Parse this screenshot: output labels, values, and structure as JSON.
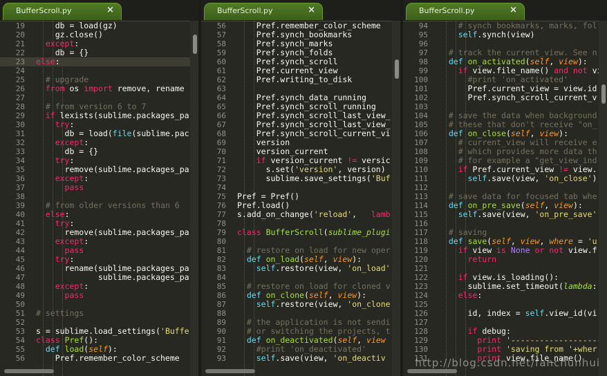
{
  "watermark": "http://blog.csdn.net/fanchunhui",
  "panes": [
    {
      "tab": "BufferScroll.py",
      "lines": [
        [
          "19",
          "    [[db = load(gz)]]"
        ],
        [
          "20",
          "    gz.close()"
        ],
        [
          "21",
          "  [[k:except]]:"
        ],
        [
          "22",
          "    db = {}"
        ],
        [
          "23",
          "[[k:else]]:"
        ],
        [
          "24",
          ""
        ],
        [
          "25",
          "  [[c:# upgrade]]"
        ],
        [
          "26",
          "  [[k:from]] os [[k:import]] remove, rename"
        ],
        [
          "27",
          ""
        ],
        [
          "28",
          "  [[c:# from version 6 to 7]]"
        ],
        [
          "29",
          "  [[k:if]] lexists(sublime.packages_pa"
        ],
        [
          "30",
          "    [[k:try]]:"
        ],
        [
          "31",
          "      db = load([[b:file]](sublime.pac"
        ],
        [
          "32",
          "    [[k:except]]:"
        ],
        [
          "33",
          "      db = {}"
        ],
        [
          "34",
          "    [[k:try]]:"
        ],
        [
          "35",
          "      remove(sublime.packages_pa"
        ],
        [
          "36",
          "    [[k:except]]:"
        ],
        [
          "37",
          "      [[k:pass]]"
        ],
        [
          "38",
          ""
        ],
        [
          "39",
          "  [[c:# from older versions than 6]]"
        ],
        [
          "40",
          "  [[k:else]]:"
        ],
        [
          "41",
          "    [[k:try]]:"
        ],
        [
          "42",
          "      remove(sublime.packages_pa"
        ],
        [
          "43",
          "    [[k:except]]:"
        ],
        [
          "44",
          "      [[k:pass]]"
        ],
        [
          "45",
          "    [[k:try]]:"
        ],
        [
          "46",
          "      rename(sublime.packages_pa"
        ],
        [
          "47",
          "             sublime.packages_pa"
        ],
        [
          "48",
          "    [[k:except]]:"
        ],
        [
          "49",
          "      [[k:pass]]"
        ],
        [
          "50",
          ""
        ],
        [
          "51",
          "[[c:# settings]]"
        ],
        [
          "52",
          ""
        ],
        [
          "53",
          "s = sublime.load_settings([[s:'Buffe]]"
        ],
        [
          "54",
          "[[k:class]] [[f:Pref]]():"
        ],
        [
          "55",
          "  [[b:def]] [[f:load]]([[p:self]]):"
        ],
        [
          "56",
          "    Pref.remember_color_scheme"
        ]
      ]
    },
    {
      "tab": "BufferScroll.py",
      "lines": [
        [
          "56",
          "    Pref.remember_color_scheme"
        ],
        [
          "57",
          "    Pref.synch_bookmarks"
        ],
        [
          "58",
          "    Pref.synch_marks"
        ],
        [
          "59",
          "    Pref.synch_folds"
        ],
        [
          "60",
          "    Pref.synch_scroll"
        ],
        [
          "61",
          "    Pref.current_view"
        ],
        [
          "62",
          "    Pref.writing_to_disk"
        ],
        [
          "63",
          ""
        ],
        [
          "64",
          "    Pref.synch_data_running"
        ],
        [
          "65",
          "    Pref.synch_scroll_running"
        ],
        [
          "66",
          "    Pref.synch_scroll_last_view_"
        ],
        [
          "67",
          "    Pref.synch_scroll_last_view_"
        ],
        [
          "68",
          "    Pref.synch_scroll_current_vi"
        ],
        [
          "69",
          "    version"
        ],
        [
          "70",
          "    version_current"
        ],
        [
          "71",
          "    [[k:if]] version_current [[k:!=]] versic"
        ],
        [
          "72",
          "      s.set([[s:'version']], version)"
        ],
        [
          "73",
          "      sublime.save_settings([[s:'Buf]]"
        ],
        [
          "74",
          ""
        ],
        [
          "75",
          "Pref = Pref()"
        ],
        [
          "76",
          "Pref.load()"
        ],
        [
          "77",
          "s.add_on_change([[s:'reload']],   [[k:lamb]]"
        ],
        [
          "78",
          ""
        ],
        [
          "79",
          "[[k:class]] [[f:BufferScroll]]([[ih:sublime_plugi]]"
        ],
        [
          "80",
          ""
        ],
        [
          "81",
          "  [[c:# restore on load for new oper]]"
        ],
        [
          "82",
          "  [[b:def]] [[f:on_load]]([[p:self]], [[p:view]]):"
        ],
        [
          "83",
          "    [[b:self]].restore(view, [[s:'on_load']]"
        ],
        [
          "84",
          ""
        ],
        [
          "85",
          "  [[c:# restore on load for cloned v]]"
        ],
        [
          "86",
          "  [[b:def]] [[f:on_clone]]([[p:self]], [[p:view]]):"
        ],
        [
          "87",
          "    [[b:self]].restore(view, [[s:'on_clone]]"
        ],
        [
          "88",
          ""
        ],
        [
          "89",
          "  [[c:# the application is not sendi]]"
        ],
        [
          "90",
          "  [[c:# or switching the projects, t]]"
        ],
        [
          "91",
          "  [[b:def]] [[f:on_deactivated]]([[p:self]], [[p:view]]"
        ],
        [
          "92",
          "    [[c:#print 'on_deactivated']]"
        ],
        [
          "93",
          "    [[b:self]].save(view, [[s:'on_deactiv]]"
        ]
      ]
    },
    {
      "tab": "BufferScroll.py",
      "lines": [
        [
          "94",
          "    [[c:# synch bookmarks, marks, fol]]"
        ],
        [
          "95",
          "    [[b:self]].synch(view)"
        ],
        [
          "96",
          ""
        ],
        [
          "97",
          "  [[c:# track the current_view. See n]]"
        ],
        [
          "98",
          "  [[b:def]] [[f:on_activated]]([[p:self]], [[p:view]]):"
        ],
        [
          "99",
          "    [[k:if]] view.file_name() [[k:and]] [[k:not]] vi"
        ],
        [
          "100",
          "      [[c:#print 'on_activated']]"
        ],
        [
          "101",
          "      Pref.current_view = view.id"
        ],
        [
          "102",
          "      Pref.synch_scroll_current_v"
        ],
        [
          "103",
          ""
        ],
        [
          "104",
          "  [[c:# save the data when background]]"
        ],
        [
          "105",
          "  [[c:# these that don't receive \"on_]]"
        ],
        [
          "106",
          "  [[b:def]] [[f:on_close]]([[p:self]], [[p:view]]):"
        ],
        [
          "107",
          "    [[c:# current_view will receive e]]"
        ],
        [
          "108",
          "    [[c:# which provides more data th]]"
        ],
        [
          "109",
          "    [[c:# for example a \"get_view_ind]]"
        ],
        [
          "110",
          "    [[k:if]] Pref.current_view [[k:!=]] view."
        ],
        [
          "111",
          "      [[b:self]].save(view, [[s:'on_close']])"
        ],
        [
          "112",
          ""
        ],
        [
          "113",
          "  [[c:# save data for focused tab whe]]"
        ],
        [
          "114",
          "  [[b:def]] [[f:on_pre_save]]([[p:self]], [[p:view]]):"
        ],
        [
          "115",
          "    [[b:self]].save(view, [[s:'on_pre_save']]"
        ],
        [
          "116",
          ""
        ],
        [
          "117",
          "  [[c:# saving]]"
        ],
        [
          "118",
          "  [[b:def]] [[f:save]]([[p:self]], [[p:view]], [[p:where]] = [[s:'u]]"
        ],
        [
          "119",
          "    [[k:if]] view [[k:is]] [[n:None]] [[k:or]] [[k:not]] view.f"
        ],
        [
          "120",
          "      [[k:return]]"
        ],
        [
          "121",
          ""
        ],
        [
          "122",
          "    [[k:if]] view.is_loading():"
        ],
        [
          "123",
          "      sublime.set_timeout([[ih:lambda]]:"
        ],
        [
          "124",
          "    [[k:else]]:"
        ],
        [
          "125",
          ""
        ],
        [
          "126",
          "      id, index = [[b:self]].view_id(vi"
        ],
        [
          "127",
          ""
        ],
        [
          "128",
          "      [[k:if]] debug:"
        ],
        [
          "129",
          "        [[k:print]] [[s:'--------------------]]"
        ],
        [
          "130",
          "        [[k:print]] [[s:'saving from '+wher]]"
        ],
        [
          "131",
          "        [[k:print]] view.file_name()"
        ]
      ]
    }
  ]
}
